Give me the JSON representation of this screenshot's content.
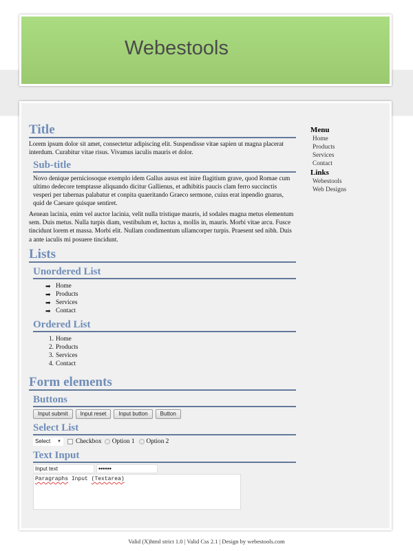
{
  "header": {
    "site_title": "Webestools"
  },
  "content": {
    "title": "Title",
    "intro": "Lorem ipsum dolor sit amet, consectetur adipiscing elit. Suspendisse vitae sapien ut magna placerat interdum. Curabitur vitae risus. Vivamus iaculis mauris et dolor.",
    "subtitle": "Sub-title",
    "sub_paragraph": "Novo denique perniciosoque exemplo idem Gallus ausus est inire flagitium grave, quod Romae cum ultimo dedecore temptasse aliquando dicitur Gallienus, et adhibitis paucis clam ferro succinctis vesperi per tabernas palabatur et conpita quaeritando Graeco sermone, cuius erat inpendio gnarus, quid de Caesare quisque sentiret.",
    "paragraph2": "Aenean lacinia, enim vel auctor lacinia, velit nulla tristique mauris, id sodales magna metus elementum sem. Duis metus. Nulla turpis diam, vestibulum et, luctus a, mollis in, mauris. Morbi vitae arcu. Fusce tincidunt lorem et massa. Morbi elit. Nullam condimentum ullamcorper turpis. Praesent sed nibh. Duis a ante iaculis mi posuere tincidunt.",
    "lists_title": "Lists",
    "unordered_title": "Unordered List",
    "unordered_items": [
      "Home",
      "Products",
      "Services",
      "Contact"
    ],
    "ordered_title": "Ordered List",
    "ordered_items": [
      {
        "num": "1.",
        "label": "Home"
      },
      {
        "num": "2.",
        "label": "Products"
      },
      {
        "num": "3.",
        "label": "Services"
      },
      {
        "num": "4.",
        "label": "Contact"
      }
    ],
    "form_title": "Form elements",
    "buttons_title": "Buttons",
    "buttons": [
      "Input submit",
      "Input reset",
      "Input button",
      "Button"
    ],
    "select_title": "Select List",
    "select_value": "Select",
    "checkbox_label": "Checkbox",
    "radio_labels": [
      "Option 1",
      "Option 2"
    ],
    "text_input_title": "Text Input",
    "text_input_value": "Input text",
    "password_value": "••••••",
    "textarea_value": [
      "Paragraphs",
      "Input",
      "(Textarea)"
    ]
  },
  "sidebar": {
    "menu_title": "Menu",
    "menu_items": [
      "Home",
      "Products",
      "Services",
      "Contact"
    ],
    "links_title": "Links",
    "links_items": [
      "Webestools",
      "Web Designs"
    ]
  },
  "footer": {
    "text": "Valid (X)html strict 1.0 | Valid Css 2.1 | Design by webestools.com"
  },
  "colors": {
    "header_green_top": "#abdc82",
    "header_green_bottom": "#9bc96f",
    "heading_blue": "#6f8db8",
    "rule_blue": "#62789a",
    "panel_gray": "#f0f0f0"
  }
}
